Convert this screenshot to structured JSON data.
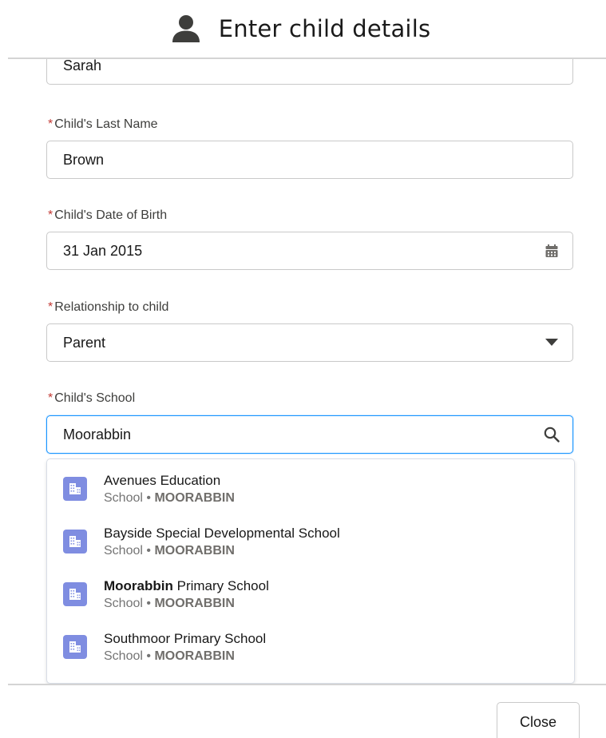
{
  "header": {
    "title": "Enter child details",
    "icon": "user-icon"
  },
  "form": {
    "first_name": {
      "value": "Sarah"
    },
    "last_name": {
      "label": "Child's Last Name",
      "required_mark": "*",
      "value": "Brown"
    },
    "date_of_birth": {
      "label": "Child's Date of Birth",
      "required_mark": "*",
      "value": "31 Jan 2015",
      "icon": "calendar-icon"
    },
    "relationship": {
      "label": "Relationship to child",
      "required_mark": "*",
      "value": "Parent",
      "icon": "caret-down-icon"
    },
    "school": {
      "label": "Child's School",
      "required_mark": "*",
      "value": "Moorabbin",
      "icon": "search-icon",
      "options": [
        {
          "title_bold": "",
          "title_rest": "Avenues Education",
          "type": "School",
          "separator": "•",
          "suburb": "MOORABBIN"
        },
        {
          "title_bold": "",
          "title_rest": "Bayside Special Developmental School",
          "type": "School",
          "separator": "•",
          "suburb": "MOORABBIN"
        },
        {
          "title_bold": "Moorabbin",
          "title_rest": " Primary School",
          "type": "School",
          "separator": "•",
          "suburb": "MOORABBIN"
        },
        {
          "title_bold": "",
          "title_rest": "Southmoor Primary School",
          "type": "School",
          "separator": "•",
          "suburb": "MOORABBIN"
        }
      ]
    }
  },
  "footer": {
    "close_label": "Close"
  },
  "colors": {
    "required": "#c23934",
    "focus": "#1b96ff",
    "school_icon_bg": "#7f8de1"
  }
}
